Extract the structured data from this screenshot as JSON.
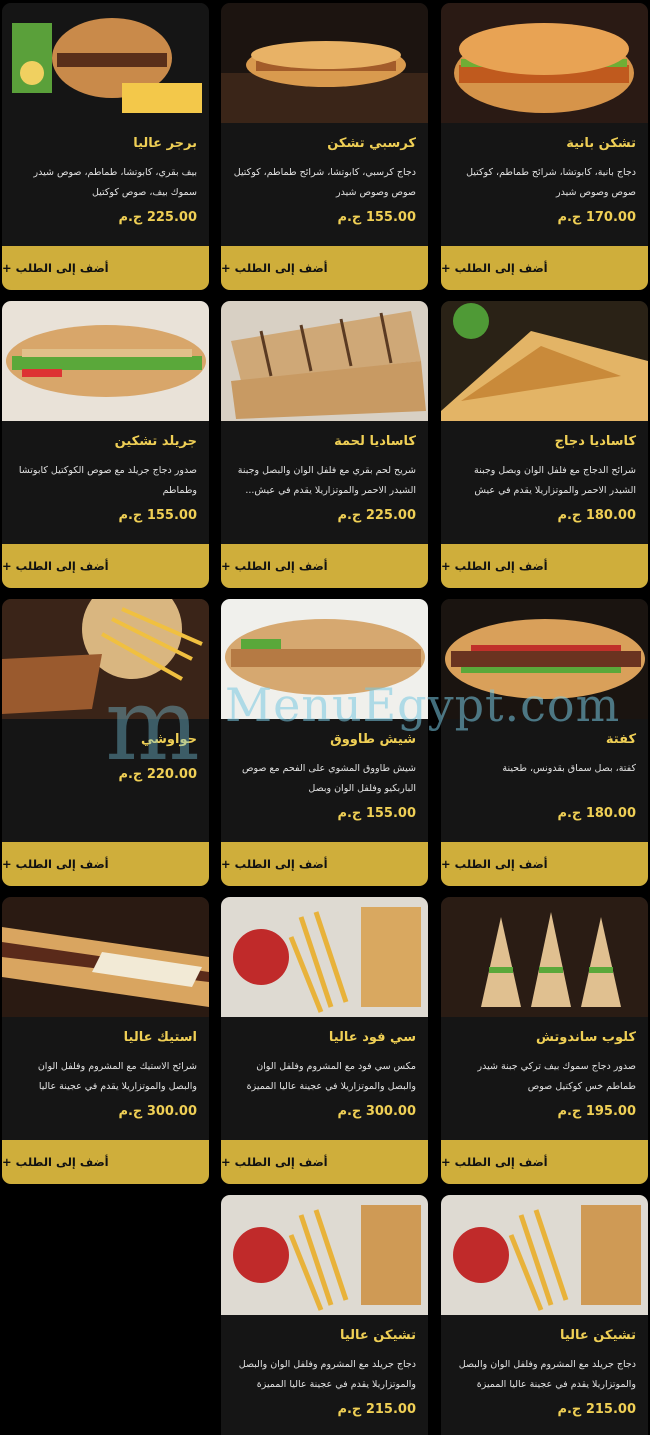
{
  "add_button_label": "أضف إلى الطلب +",
  "watermark": "MenuEgypt.com",
  "currency_note": "ج.م",
  "products": [
    {
      "title": "تشكن بانية",
      "desc": "دجاج بانية، كابوتشا، شرائح طماطم، كوكتيل صوص وصوص شيدر",
      "price": "170.00 ج.م",
      "image": "chicken-burger"
    },
    {
      "title": "كرسبي تشكن",
      "desc": "دجاج كرسبي، كابوتشا، شرائح طماطم، كوكتيل صوص وصوص شيدر",
      "price": "155.00 ج.م",
      "image": "crispy-sandwich"
    },
    {
      "title": "برجر عاليا",
      "desc": "بيف بقري، كابوتشا، طماطم، صوص شيدر سموك بيف، صوص كوكتيل",
      "price": "225.00 ج.م",
      "image": "beef-burger"
    },
    {
      "title": "كاساديا دجاج",
      "desc": "شرائح الدجاج مع فلفل الوان وبصل وجبنة الشيدر الاحمر والموتزاريلا يقدم في عيش التورتيلا",
      "price": "180.00 ج.م",
      "image": "quesadilla"
    },
    {
      "title": "كاساديا لحمة",
      "desc": "شريح لحم بقري مع فلفل الوان والبصل وجبنة الشيدر الاحمر والموتزاريلا يقدم في عيش...",
      "price": "225.00 ج.م",
      "image": "grilled-flatbread"
    },
    {
      "title": "جريلد تشكين",
      "desc": "صدور دجاج جريلد مع صوص الكوكتيل كابوتشا وطماطم",
      "price": "155.00 ج.م",
      "image": "grilled-sub"
    },
    {
      "title": "كفتة",
      "desc": "كفتة، بصل سماق بقدونس، طحينة",
      "price": "180.00 ج.م",
      "image": "kofta"
    },
    {
      "title": "شيش طاووق",
      "desc": "شيش طاووق المشوي على الفحم مع صوص الباربكيو وفلفل الوان وبصل",
      "price": "155.00 ج.م",
      "image": "shish-tawook"
    },
    {
      "title": "حواوشي",
      "desc": "",
      "price": "220.00 ج.م",
      "image": "hawawshi"
    },
    {
      "title": "كلوب ساندوتش",
      "desc": "صدور دجاج سموك بيف تركي جبنة شيدر طماطم خس كوكتيل صوص",
      "price": "195.00 ج.م",
      "image": "club-sandwich"
    },
    {
      "title": "سي فود عاليا",
      "desc": "مكس سي فود مع المشروم وفلفل الوان والبصل والموتزاريلا في عجينة عاليا المميزة",
      "price": "300.00 ج.م",
      "image": "seafood-platter"
    },
    {
      "title": "استيك عاليا",
      "desc": "شرائح الاستيك مع المشروم وفلفل الوان والبصل والموتزاريلا يقدم في عجينة عاليا",
      "price": "300.00 ج.م",
      "image": "steak-sub"
    },
    {
      "title": "تشيكن عاليا",
      "desc": "دجاج جريلد مع المشروم وفلفل الوان والبصل والموتزاريلا يقدم في عجينة عاليا المميزة",
      "price": "215.00 ج.م",
      "image": "chicken-platter"
    },
    {
      "title": "تشيكن عاليا",
      "desc": "دجاج جريلد مع المشروم وفلفل الوان والبصل والموتزاريلا يقدم في عجينة عاليا المميزة",
      "price": "215.00 ج.م",
      "image": "chicken-platter"
    }
  ]
}
